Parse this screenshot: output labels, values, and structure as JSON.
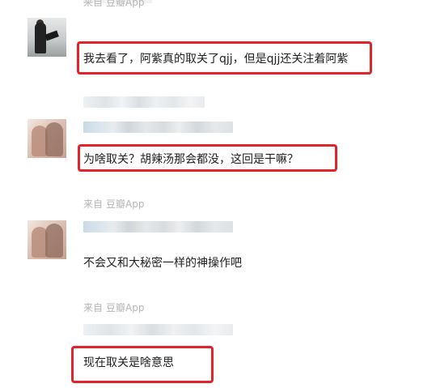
{
  "comments": [
    {
      "source": {
        "prefix": "来自",
        "app": "豆瓣App"
      },
      "avatar": "user-avatar-photo",
      "text": "我去看了，阿紫真的取关了qjj，但是qjj还关注着阿紫",
      "highlighted": true
    },
    {
      "avatar": "user-avatar-illustration",
      "text": "为啥取关？胡辣汤那会都没，这回是干嘛？",
      "highlighted": true
    },
    {
      "source": {
        "prefix": "来自",
        "app": "豆瓣App"
      },
      "avatar": "user-avatar-illustration",
      "text": "不会又和大秘密一样的神操作吧",
      "highlighted": false
    },
    {
      "source": {
        "prefix": "来自",
        "app": "豆瓣App"
      },
      "text": "现在取关是啥意思",
      "highlighted": true
    }
  ],
  "colors": {
    "highlight": "#e0242a",
    "source_text": "#b6b6b6",
    "body_text": "#222222"
  }
}
